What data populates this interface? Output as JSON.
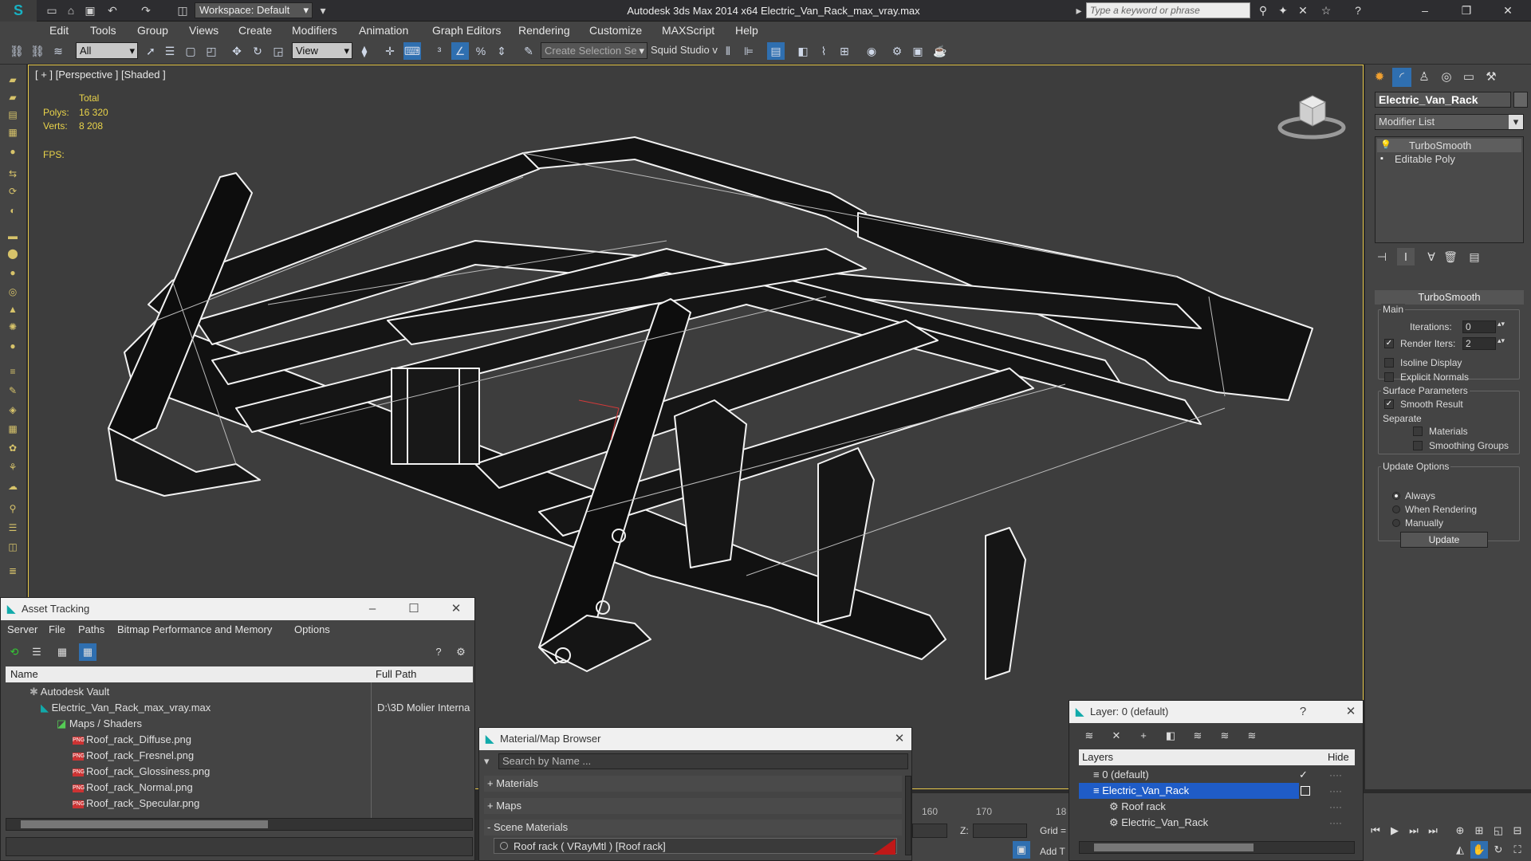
{
  "app": {
    "title": "Autodesk 3ds Max  2014 x64      Electric_Van_Rack_max_vray.max",
    "workspace": "Workspace: Default",
    "search_placeholder": "Type a keyword or phrase"
  },
  "menu": [
    "Edit",
    "Tools",
    "Group",
    "Views",
    "Create",
    "Modifiers",
    "Animation",
    "Graph Editors",
    "Rendering",
    "Customize",
    "MAXScript",
    "Help"
  ],
  "toolbar": {
    "selection_filter": "All",
    "reference_coord": "View",
    "named_selection": "Create Selection Se",
    "squid_studio": "Squid Studio v"
  },
  "viewport": {
    "label": "[ + ] [Perspective ] [Shaded ]",
    "stats_header": "Total",
    "polys_label": "Polys:",
    "polys_value": "16 320",
    "verts_label": "Verts:",
    "verts_value": "8 208",
    "fps_label": "FPS:"
  },
  "command_panel": {
    "object_name": "Electric_Van_Rack",
    "modifier_list": "Modifier List",
    "stack": [
      "TurboSmooth",
      "Editable Poly"
    ],
    "rollout_title": "TurboSmooth",
    "main_group": "Main",
    "iterations_label": "Iterations:",
    "iterations_value": "0",
    "render_iters_label": "Render Iters:",
    "render_iters_value": "2",
    "isoline_display": "Isoline Display",
    "explicit_normals": "Explicit Normals",
    "surface_params_group": "Surface Parameters",
    "smooth_result": "Smooth Result",
    "separate_label": "Separate",
    "materials": "Materials",
    "smoothing_groups": "Smoothing Groups",
    "update_options_group": "Update Options",
    "always": "Always",
    "when_rendering": "When Rendering",
    "manually": "Manually",
    "update_button": "Update"
  },
  "asset_tracking": {
    "title": "Asset Tracking",
    "menu": [
      "Server",
      "File",
      "Paths",
      "Bitmap Performance and Memory",
      "Options"
    ],
    "col_name": "Name",
    "col_path": "Full Path",
    "rows": [
      {
        "name": "Autodesk Vault",
        "path": ""
      },
      {
        "name": "Electric_Van_Rack_max_vray.max",
        "path": "D:\\3D Molier Interna"
      },
      {
        "name": "Maps / Shaders",
        "path": ""
      },
      {
        "name": "Roof_rack_Diffuse.png",
        "path": ""
      },
      {
        "name": "Roof_rack_Fresnel.png",
        "path": ""
      },
      {
        "name": "Roof_rack_Glossiness.png",
        "path": ""
      },
      {
        "name": "Roof_rack_Normal.png",
        "path": ""
      },
      {
        "name": "Roof_rack_Specular.png",
        "path": ""
      }
    ],
    "png_badge": "PNG"
  },
  "material_browser": {
    "title": "Material/Map Browser",
    "search_placeholder": "Search by Name ...",
    "sections": [
      "+ Materials",
      "+ Maps",
      "- Scene Materials"
    ],
    "scene_material": "Roof rack  ( VRayMtl )  [Roof rack]"
  },
  "layer_panel": {
    "title": "Layer: 0 (default)",
    "help": "?",
    "col_layers": "Layers",
    "col_hide": "Hide",
    "rows": [
      "0 (default)",
      "Electric_Van_Rack",
      "Roof rack",
      "Electric_Van_Rack"
    ]
  },
  "timeline": {
    "ticks": [
      "160",
      "170",
      "18"
    ],
    "z_label": "Z:",
    "grid_label": "Grid =",
    "add_time_tag": "Add T"
  },
  "colors": {
    "accent_selected": "#1f5cc7",
    "viewport_border": "#e8c94a",
    "stats": "#e9d34a",
    "material_swatch": "#c01818"
  }
}
